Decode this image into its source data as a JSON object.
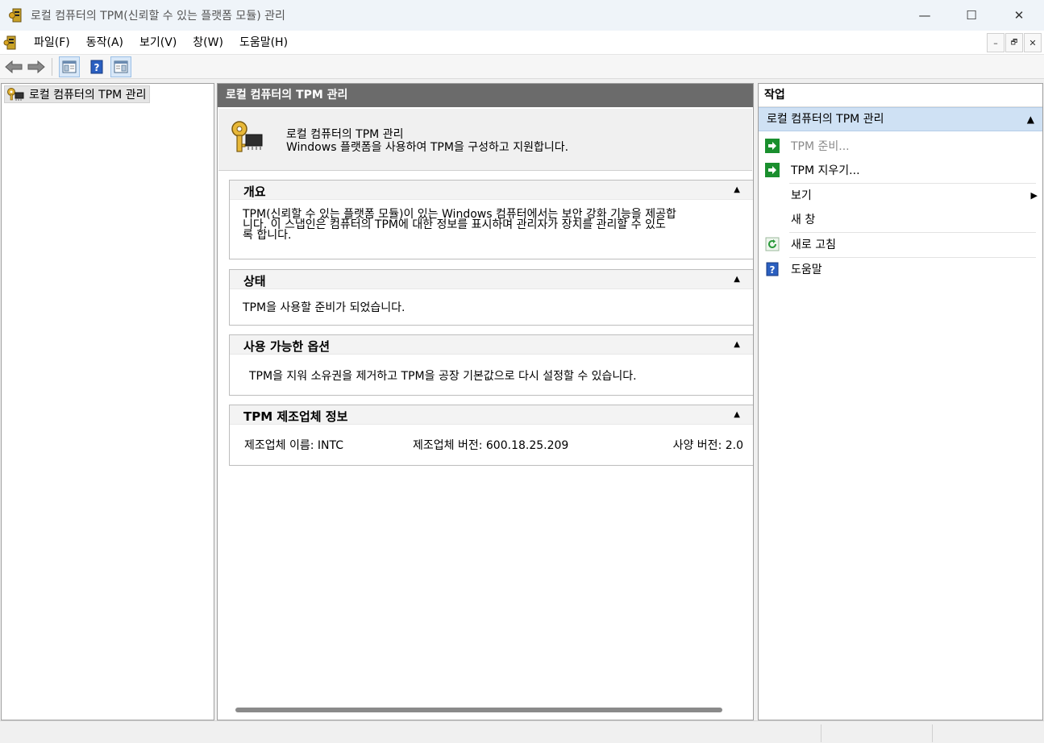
{
  "window": {
    "title": "로컬 컴퓨터의 TPM(신뢰할 수 있는 플랫폼 모듈) 관리",
    "minimize": "—",
    "maximize": "☐",
    "close": "✕"
  },
  "menu": {
    "items": [
      "파일(F)",
      "동작(A)",
      "보기(V)",
      "창(W)",
      "도움말(H)"
    ],
    "mdi_minimize": "–",
    "mdi_restore": "🗗",
    "mdi_close": "✕"
  },
  "tree": {
    "root_label": "로컬 컴퓨터의 TPM 관리"
  },
  "center": {
    "header": "로컬 컴퓨터의 TPM 관리",
    "intro_title": "로컬 컴퓨터의 TPM 관리",
    "intro_desc": "Windows 플랫폼을 사용하여 TPM을 구성하고 지원합니다.",
    "overview": {
      "title": "개요",
      "line1": "TPM(신뢰할 수 있는 플랫폼 모듈)이 있는 Windows 컴퓨터에서는 보안 강화 기능을 제공합",
      "line2": "니다. 이 스냅인은 컴퓨터의 TPM에 대한 정보를 표시하며 관리자가 장치를 관리할 수 있도",
      "line3": "록 합니다."
    },
    "status": {
      "title": "상태",
      "text": "TPM을 사용할 준비가 되었습니다."
    },
    "options": {
      "title": "사용 가능한 옵션",
      "text": "TPM을 지워 소유권을 제거하고 TPM을 공장 기본값으로 다시 설정할 수 있습니다."
    },
    "manufacturer": {
      "title": "TPM 제조업체 정보",
      "name": "제조업체 이름: INTC",
      "version": "제조업체 버전: 600.18.25.209",
      "spec": "사양 버전: 2.0"
    },
    "collapse_arrow": "▲"
  },
  "actions": {
    "title": "작업",
    "group": "로컬 컴퓨터의 TPM 관리",
    "group_arrow": "▲",
    "prepare": "TPM 준비...",
    "clear": "TPM 지우기...",
    "view": "보기",
    "view_arrow": "▶",
    "new_window": "새 창",
    "refresh": "새로 고침",
    "help": "도움말"
  },
  "colors": {
    "header_gray": "#6b6b6b",
    "action_group_blue": "#cfe1f4",
    "disabled_text": "#8a8a8a",
    "action_green": "#1a8f2e"
  }
}
